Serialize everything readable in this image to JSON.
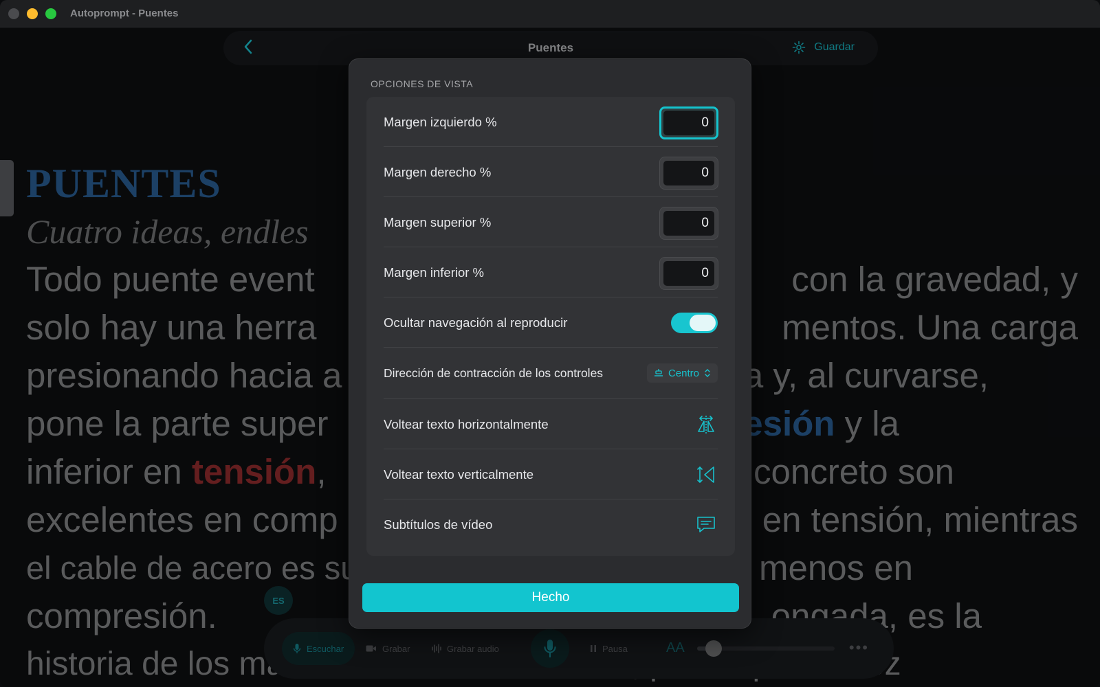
{
  "window": {
    "title": "Autoprompt - Puentes"
  },
  "topbar": {
    "doc_name": "Puentes",
    "save_label": "Guardar"
  },
  "script": {
    "title": "PUENTES",
    "subtitle": "Cuatro ideas, endles",
    "lines": [
      {
        "left": "Todo puente event",
        "right": "con la gravedad, y"
      },
      {
        "left": "solo hay una herra",
        "right": "mentos. Una carga"
      },
      {
        "left": "presionando hacia a",
        "right": "a y, al curvarse,"
      },
      {
        "left": "pone la parte super",
        "right_hl": "esión",
        "right": " y la"
      },
      {
        "left": "inferior en ",
        "left_hl": "tensión",
        "left_after": ",",
        "right": "concreto son"
      },
      {
        "left": "excelentes en comp",
        "right": "en tensión, mientras"
      },
      {
        "left": "el cable de acero es sup",
        "right": "menos en"
      },
      {
        "left": "compresión.",
        "right": "ongada, es la"
      },
      {
        "left": "historia de los materiales de construcción, por lo que tal vez",
        "right": ""
      }
    ],
    "lang_badge": "ES"
  },
  "controls": {
    "listen": "Escuchar",
    "record": "Grabar",
    "record_audio": "Grabar audio",
    "pause": "Pausa",
    "font_size_glyph": "AA",
    "more": "•••",
    "speed_level": 0.12
  },
  "modal": {
    "section_label": "OPCIONES DE VISTA",
    "margin_left": {
      "label": "Margen izquierdo %",
      "value": "0"
    },
    "margin_right": {
      "label": "Margen derecho %",
      "value": "0"
    },
    "margin_top": {
      "label": "Margen superior %",
      "value": "0"
    },
    "margin_bottom": {
      "label": "Margen inferior %",
      "value": "0"
    },
    "hide_nav": {
      "label": "Ocultar navegación al reproducir",
      "on": true
    },
    "collapse_dir": {
      "label": "Dirección de contracción de los controles",
      "value": "Centro"
    },
    "flip_h": {
      "label": "Voltear texto horizontalmente"
    },
    "flip_v": {
      "label": "Voltear texto verticalmente"
    },
    "subtitles": {
      "label": "Subtítulos de vídeo"
    },
    "done_label": "Hecho"
  },
  "colors": {
    "accent": "#12c5cf",
    "tension": "#8b2a2c",
    "compression": "#27598c"
  }
}
